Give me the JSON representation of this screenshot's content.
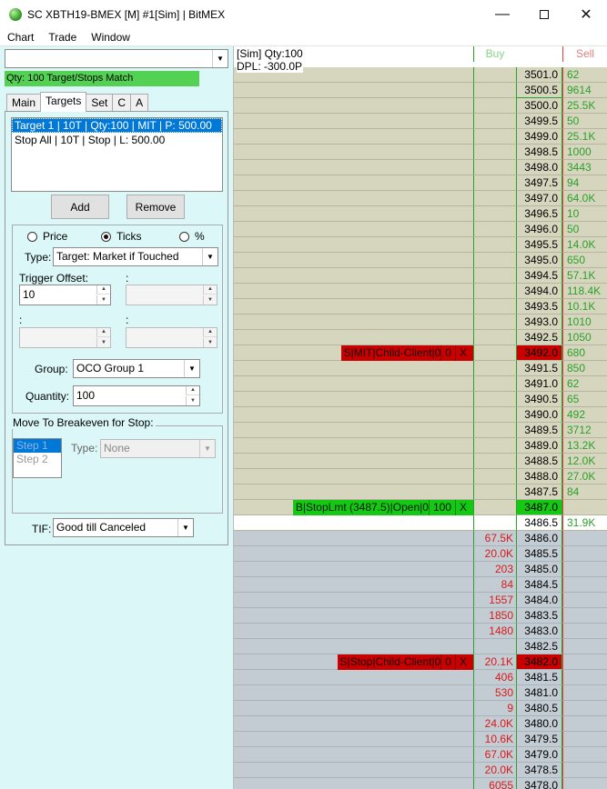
{
  "window": {
    "title": "SC XBTH19-BMEX [M]  #1[Sim]  | BitMEX",
    "minimize": "—",
    "close": "✕"
  },
  "menu": [
    "Chart",
    "Trade",
    "Window"
  ],
  "left": {
    "symbol_value": "",
    "status": "Qty: 100 Target/Stops Match",
    "tabs": [
      "Main",
      "Targets",
      "Set",
      "C",
      "A"
    ],
    "active_tab": "Targets",
    "targets": [
      {
        "label": "Target 1 | 10T | Qty:100 | MIT | P: 500.00",
        "selected": true
      },
      {
        "label": "Stop All | 10T | Stop | L: 500.00",
        "selected": false
      }
    ],
    "add_label": "Add",
    "remove_label": "Remove",
    "radio": {
      "price": "Price",
      "ticks": "Ticks",
      "percent": "%",
      "selected": "ticks"
    },
    "type_label": "Type:",
    "type_value": "Target: Market if Touched",
    "trigger_offset_label": "Trigger Offset:",
    "trigger_offset_value": "10",
    "colon": ":",
    "group_label": "Group:",
    "group_value": "OCO Group 1",
    "quantity_label": "Quantity:",
    "quantity_value": "100",
    "breakeven_title": "Move To Breakeven for Stop:",
    "steps": [
      "Step 1",
      "Step 2"
    ],
    "be_type_label": "Type:",
    "be_type_value": "None",
    "tif_label": "TIF:",
    "tif_value": "Good till Canceled"
  },
  "dom": {
    "info_line1": "[Sim]  Qty:100",
    "info_line2": "DPL: -300.0P",
    "header_buy": "Buy",
    "header_sell": "Sell",
    "rows": [
      {
        "price": "3501.0",
        "buy": "",
        "sell": "62",
        "side": "ask"
      },
      {
        "price": "3500.5",
        "buy": "",
        "sell": "9614",
        "side": "ask"
      },
      {
        "price": "3500.0",
        "buy": "",
        "sell": "25.5K",
        "side": "ask"
      },
      {
        "price": "3499.5",
        "buy": "",
        "sell": "50",
        "side": "ask"
      },
      {
        "price": "3499.0",
        "buy": "",
        "sell": "25.1K",
        "side": "ask"
      },
      {
        "price": "3498.5",
        "buy": "",
        "sell": "1000",
        "side": "ask"
      },
      {
        "price": "3498.0",
        "buy": "",
        "sell": "3443",
        "side": "ask"
      },
      {
        "price": "3497.5",
        "buy": "",
        "sell": "94",
        "side": "ask"
      },
      {
        "price": "3497.0",
        "buy": "",
        "sell": "64.0K",
        "side": "ask"
      },
      {
        "price": "3496.5",
        "buy": "",
        "sell": "10",
        "side": "ask"
      },
      {
        "price": "3496.0",
        "buy": "",
        "sell": "50",
        "side": "ask"
      },
      {
        "price": "3495.5",
        "buy": "",
        "sell": "14.0K",
        "side": "ask"
      },
      {
        "price": "3495.0",
        "buy": "",
        "sell": "650",
        "side": "ask"
      },
      {
        "price": "3494.5",
        "buy": "",
        "sell": "57.1K",
        "side": "ask"
      },
      {
        "price": "3494.0",
        "buy": "",
        "sell": "118.4K",
        "side": "ask"
      },
      {
        "price": "3493.5",
        "buy": "",
        "sell": "10.1K",
        "side": "ask"
      },
      {
        "price": "3493.0",
        "buy": "",
        "sell": "1010",
        "side": "ask"
      },
      {
        "price": "3492.5",
        "buy": "",
        "sell": "1050",
        "side": "ask"
      },
      {
        "price": "3492.0",
        "buy": "",
        "sell": "680",
        "side": "ask",
        "highlight": "red",
        "order": [
          "S|MIT|Child-Client|0",
          "0",
          "X"
        ]
      },
      {
        "price": "3491.5",
        "buy": "",
        "sell": "850",
        "side": "ask"
      },
      {
        "price": "3491.0",
        "buy": "",
        "sell": "62",
        "side": "ask"
      },
      {
        "price": "3490.5",
        "buy": "",
        "sell": "65",
        "side": "ask"
      },
      {
        "price": "3490.0",
        "buy": "",
        "sell": "492",
        "side": "ask"
      },
      {
        "price": "3489.5",
        "buy": "",
        "sell": "3712",
        "side": "ask"
      },
      {
        "price": "3489.0",
        "buy": "",
        "sell": "13.2K",
        "side": "ask"
      },
      {
        "price": "3488.5",
        "buy": "",
        "sell": "12.0K",
        "side": "ask"
      },
      {
        "price": "3488.0",
        "buy": "",
        "sell": "27.0K",
        "side": "ask"
      },
      {
        "price": "3487.5",
        "buy": "",
        "sell": "84",
        "side": "ask"
      },
      {
        "price": "3487.0",
        "buy": "",
        "sell": "",
        "side": "ask",
        "highlight": "green",
        "order": [
          "B|StopLmt (3487.5)|Open|0",
          "100",
          "X"
        ]
      },
      {
        "price": "3486.5",
        "buy": "",
        "sell": "31.9K",
        "side": "last"
      },
      {
        "price": "3486.0",
        "buy": "67.5K",
        "sell": "",
        "side": "bid"
      },
      {
        "price": "3485.5",
        "buy": "20.0K",
        "sell": "",
        "side": "bid"
      },
      {
        "price": "3485.0",
        "buy": "203",
        "sell": "",
        "side": "bid"
      },
      {
        "price": "3484.5",
        "buy": "84",
        "sell": "",
        "side": "bid"
      },
      {
        "price": "3484.0",
        "buy": "1557",
        "sell": "",
        "side": "bid"
      },
      {
        "price": "3483.5",
        "buy": "1850",
        "sell": "",
        "side": "bid"
      },
      {
        "price": "3483.0",
        "buy": "1480",
        "sell": "",
        "side": "bid"
      },
      {
        "price": "3482.5",
        "buy": "",
        "sell": "",
        "side": "bid"
      },
      {
        "price": "3482.0",
        "buy": "20.1K",
        "sell": "",
        "side": "bid",
        "highlight": "red",
        "order": [
          "S|Stop|Child-Client|0",
          "0",
          "X"
        ]
      },
      {
        "price": "3481.5",
        "buy": "406",
        "sell": "",
        "side": "bid"
      },
      {
        "price": "3481.0",
        "buy": "530",
        "sell": "",
        "side": "bid"
      },
      {
        "price": "3480.5",
        "buy": "9",
        "sell": "",
        "side": "bid"
      },
      {
        "price": "3480.0",
        "buy": "24.0K",
        "sell": "",
        "side": "bid"
      },
      {
        "price": "3479.5",
        "buy": "10.6K",
        "sell": "",
        "side": "bid"
      },
      {
        "price": "3479.0",
        "buy": "67.0K",
        "sell": "",
        "side": "bid"
      },
      {
        "price": "3478.5",
        "buy": "20.0K",
        "sell": "",
        "side": "bid"
      },
      {
        "price": "3478.0",
        "buy": "6055",
        "sell": "",
        "side": "bid"
      }
    ]
  }
}
